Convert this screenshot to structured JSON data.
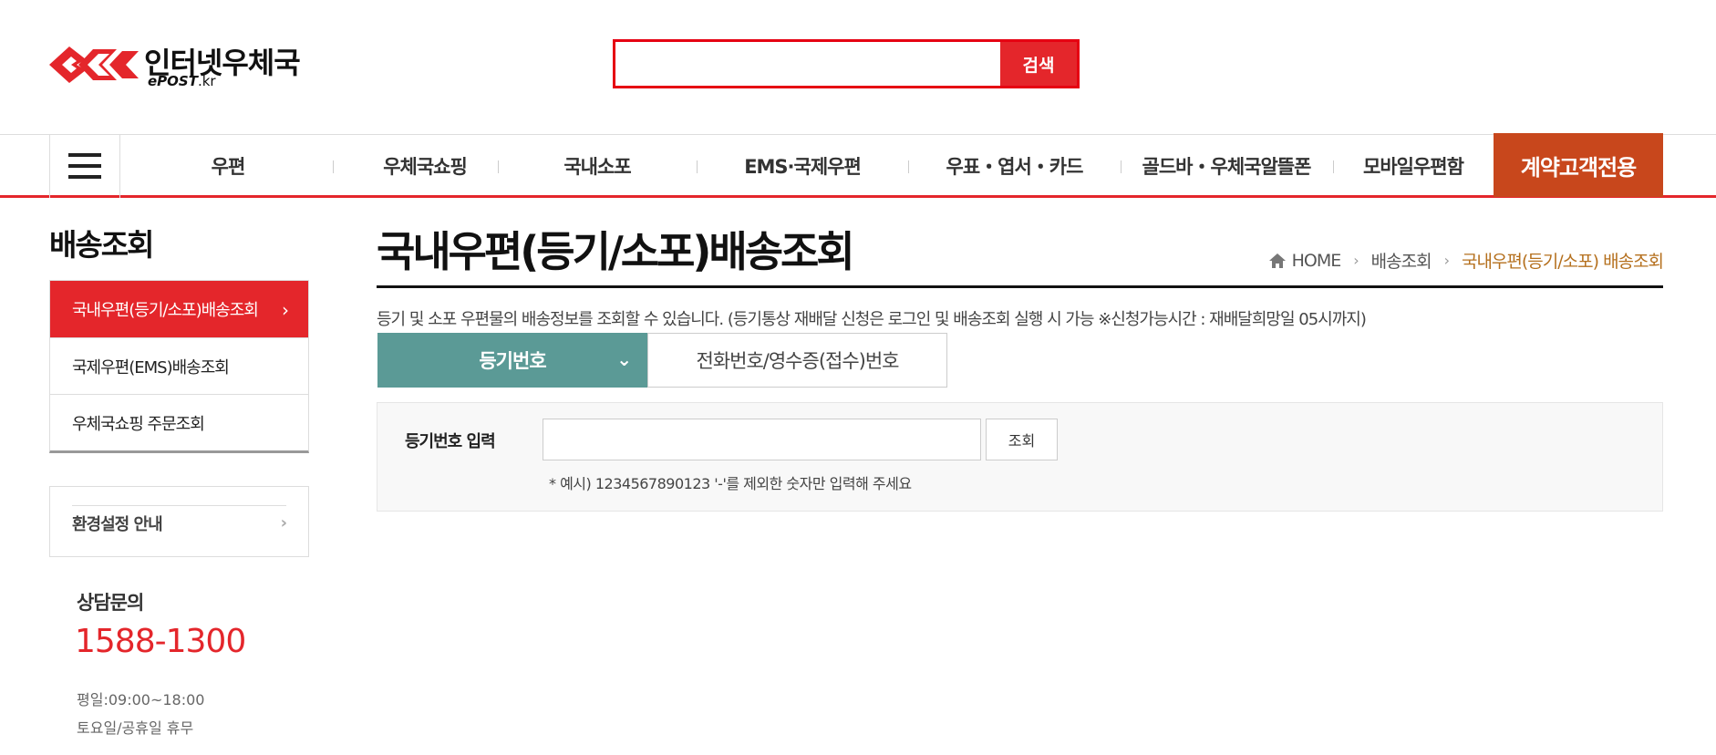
{
  "header": {
    "logo_kr": "인터넷우체국",
    "logo_en_bold": "ePOST",
    "logo_en_rest": ".kr",
    "search_placeholder": "",
    "search_button": "검색"
  },
  "nav": {
    "menu_icon": "hamburger-menu-icon",
    "items": [
      "우편",
      "우체국쇼핑",
      "국내소포",
      "EMS·국제우편",
      "우표・엽서・카드",
      "골드바・우체국알뜰폰",
      "모바일우편함"
    ],
    "contract": "계약고객전용",
    "accent_color": "#c8471c"
  },
  "sidebar": {
    "title": "배송조회",
    "items": [
      {
        "label": "국내우편(등기/소포)배송조회",
        "arrow": "›"
      },
      {
        "label": "국제우편(EMS)배송조회"
      },
      {
        "label": "우체국쇼핑 주문조회"
      }
    ],
    "env_label": "환경설정 안내",
    "env_arrow": "›",
    "consult_title": "상담문의",
    "consult_phone": "1588-1300",
    "hours_weekday": "평일:09:00~18:00",
    "hours_weekend": "토요일/공휴일 휴무"
  },
  "main": {
    "title": "국내우편(등기/소포)배송조회",
    "breadcrumb": {
      "home": "HOME",
      "sep": "›",
      "level1": "배송조회",
      "current": "국내우편(등기/소포) 배송조회"
    },
    "description": "등기 및 소포 우편물의 배송정보를 조회할 수 있습니다. (등기통상 재배달 신청은 로그인 및 배송조회 실행 시 가능 ※신청가능시간 : 재배달희망일 05시까지)",
    "tabs": [
      {
        "label": "등기번호",
        "arrow": "⌄"
      },
      {
        "label": "전화번호/영수증(접수)번호"
      }
    ],
    "form": {
      "label": "등기번호 입력",
      "input_value": "",
      "button": "조회",
      "hint": "* 예시) 1234567890123 '-'를 제외한 숫자만 입력해 주세요"
    }
  },
  "colors": {
    "brand_red": "#e4262b",
    "tab_teal": "#5b9a96",
    "breadcrumb_current": "#b5701e"
  }
}
